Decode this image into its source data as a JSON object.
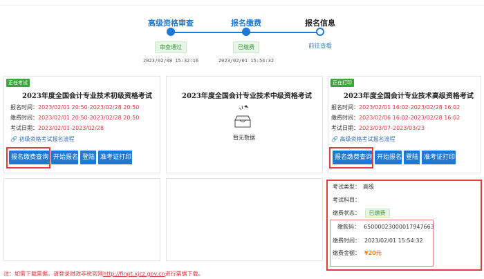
{
  "stepper": {
    "steps": [
      {
        "title": "高级资格审查",
        "badge": "审查通过",
        "time": "2023/02/08 15:32:16"
      },
      {
        "title": "报名缴费",
        "badge": "已缴费",
        "time": "2023/02/01 15:54:32"
      },
      {
        "title": "报名信息",
        "link": "前往查看"
      }
    ],
    "colors": {
      "active": "#1e78d4",
      "badge_bg": "#e8f6e8",
      "badge_text": "#3a9d3a"
    }
  },
  "cards": {
    "junior": {
      "tag": "正在考试",
      "title": "2023年度全国会计专业技术初级资格考试",
      "rows": [
        {
          "label": "报名时间：",
          "value": "2023/02/01 20:50-2023/02/28 20:50"
        },
        {
          "label": "缴费时间：",
          "value": "2023/02/01 20:50-2023/02/28 20:50"
        },
        {
          "label": "考试日期：",
          "value": "2023/02/01-2023/02/28"
        }
      ],
      "flow_link": "初级资格考试报名流程",
      "buttons": [
        "报名缴费查询",
        "开始报名",
        "登陆",
        "准考证打印"
      ]
    },
    "middle": {
      "title": "2023年度全国会计专业技术中级资格考试",
      "empty_text": "暂无数据"
    },
    "senior": {
      "tag": "正在打印",
      "title": "2023年度全国会计专业技术高级资格考试",
      "rows": [
        {
          "label": "报名时间：",
          "value": "2023/02/01 16:02-2023/02/28 16:02"
        },
        {
          "label": "缴费时间：",
          "value": "2023/02/06 16:02-2023/02/28 16:02"
        },
        {
          "label": "考试日期：",
          "value": "2023/03/07-2023/03/23"
        }
      ],
      "flow_link": "高级资格考试报名流程",
      "buttons": [
        "报名缴费查询",
        "开始报名",
        "登陆",
        "准考证打印"
      ]
    }
  },
  "detail": {
    "exam_type_label": "考试类型：",
    "exam_type_value": "高级",
    "subject_label": "考试科目：",
    "subject_value": "",
    "pay_status_label": "缴费状态：",
    "pay_status_value": "已缴费",
    "order_label": "缴款码：",
    "order_value": "65000023000017947663",
    "pay_time_label": "缴费时间：",
    "pay_time_value": "2023/02/01 15:54:32",
    "amount_label": "缴费金额：",
    "amount_value": "¥20元"
  },
  "footer": {
    "prefix": "注：如需下载票据，请登录财政非税官网",
    "url": "http://finpt.xjcz.gov.cn",
    "suffix": "进行票据下载。"
  },
  "colors": {
    "primary": "#1e78d4",
    "alert_red": "#e23b3b",
    "tag_green": "#3fa33f",
    "amount_orange": "#e08a1e"
  }
}
